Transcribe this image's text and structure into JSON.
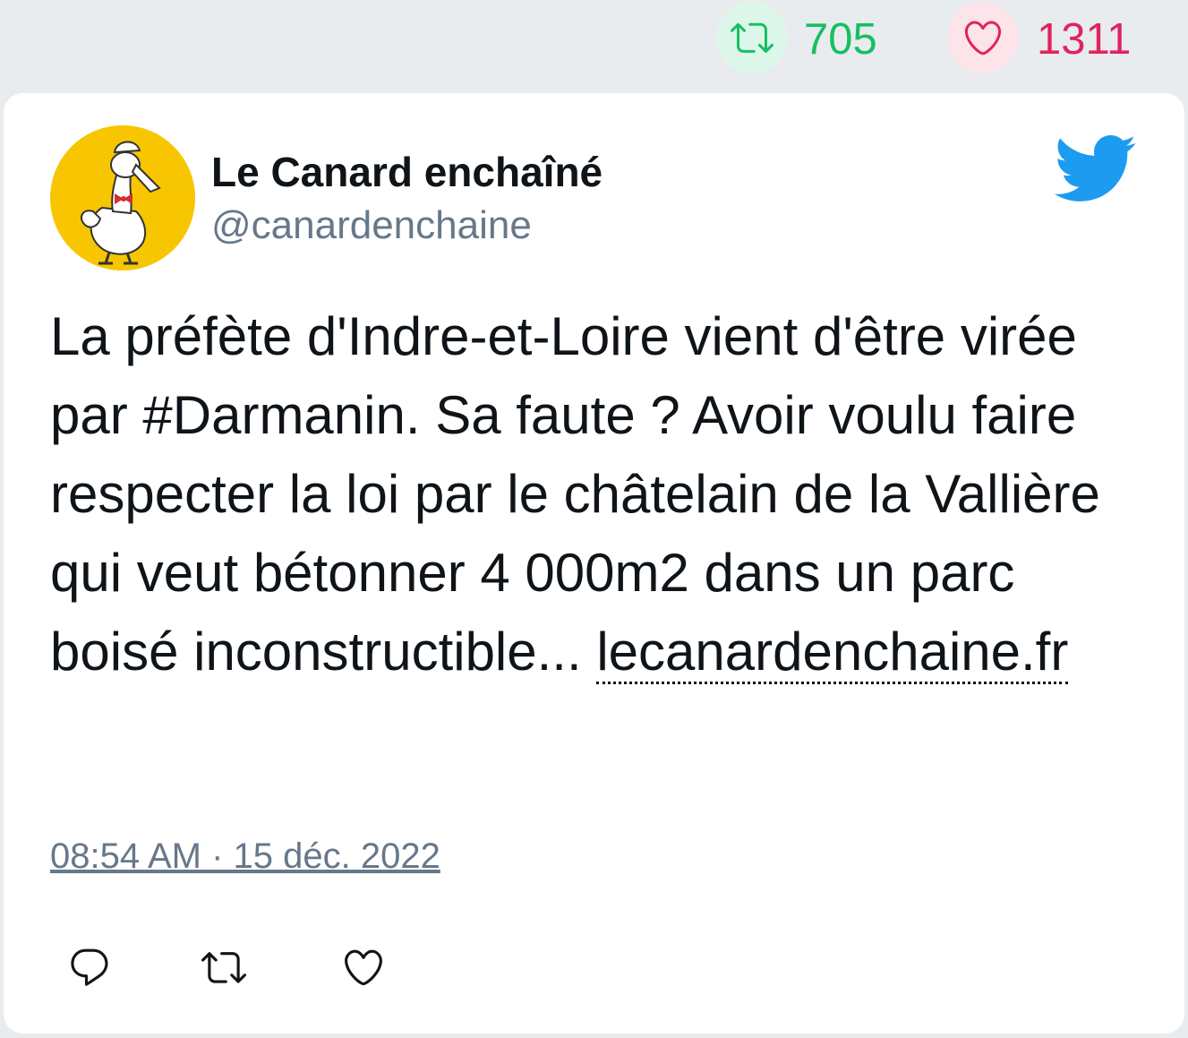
{
  "stats": {
    "retweet_icon": "retweet-icon",
    "retweet_count": "705",
    "like_icon": "heart-icon",
    "like_count": "1311",
    "retweet_color": "#17bf63",
    "like_color": "#e0245e"
  },
  "tweet": {
    "author_name": "Le Canard enchaîné",
    "author_handle": "@canardenchaine",
    "avatar_icon": "duck-logo",
    "platform_icon": "twitter-bird-icon",
    "text": "La préfète d'Indre-et-Loire vient d'être virée par #Darmanin. Sa faute ? Avoir voulu faire respecter la loi par le châtelain de la Vallière qui veut bétonner 4 000m2 dans un parc boisé inconstructible... ",
    "link_text": "lecanardenchaine.fr",
    "timestamp": "08:54 AM · 15 déc. 2022"
  },
  "actions": {
    "reply_icon": "reply-icon",
    "retweet_icon": "retweet-icon",
    "like_icon": "heart-icon"
  },
  "colors": {
    "background": "#e9ecef",
    "card": "#ffffff",
    "twitter_blue": "#1d9bf0",
    "muted_text": "#66788a",
    "avatar_bg": "#f7c600"
  }
}
